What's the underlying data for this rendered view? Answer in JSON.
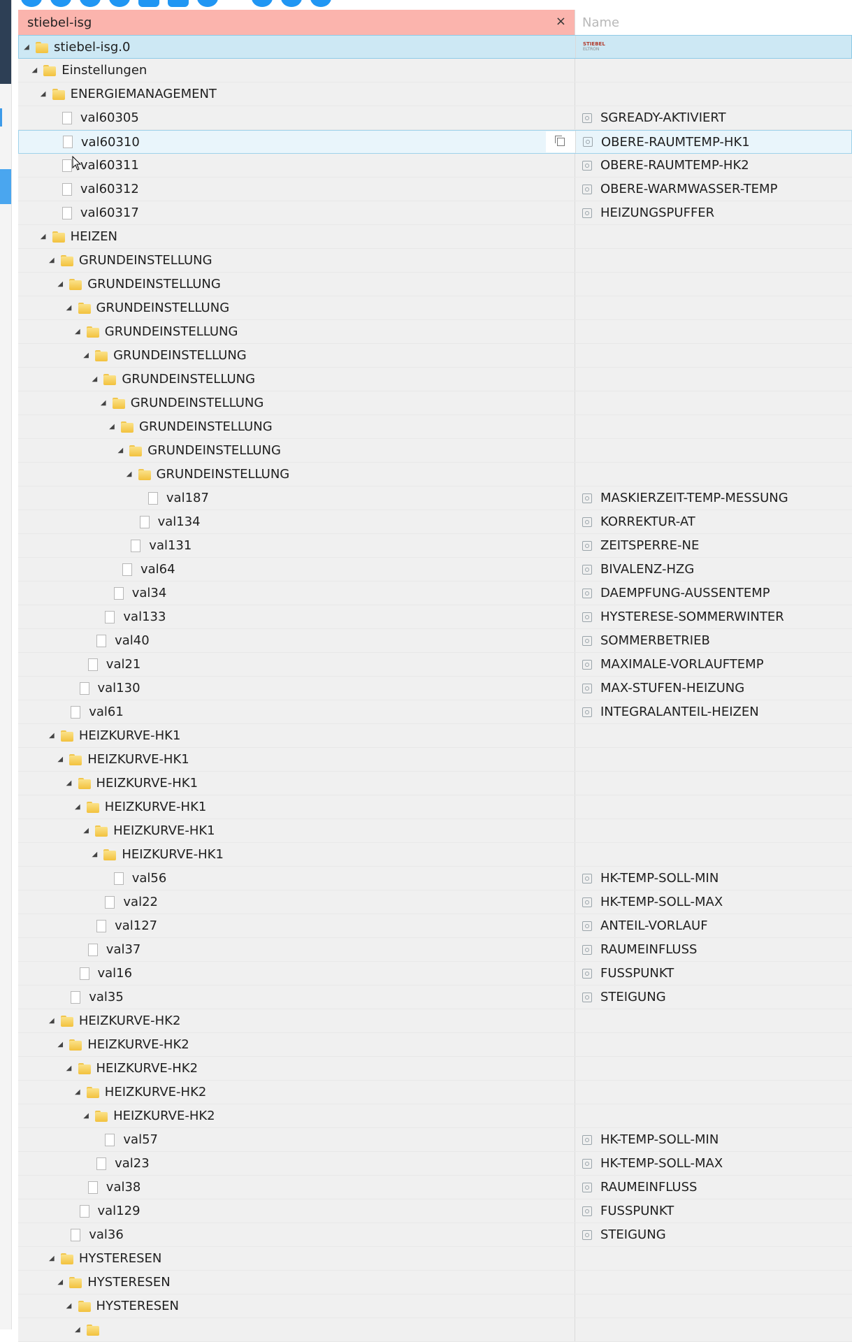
{
  "filter": {
    "value": "stiebel-isg",
    "clear": "×"
  },
  "columns": {
    "name_placeholder": "Name"
  },
  "root": {
    "label": "stiebel-isg.0",
    "logo_top": "STIEBEL",
    "logo_bottom": "ELTRON"
  },
  "rows": [
    {
      "label": "Einstellungen",
      "type": "folder",
      "level": 1,
      "name": ""
    },
    {
      "label": "ENERGIEMANAGEMENT",
      "type": "folder",
      "level": 2,
      "name": ""
    },
    {
      "label": "val60305",
      "type": "file",
      "level": 3,
      "name": "SGREADY-AKTIVIERT"
    },
    {
      "label": "val60310",
      "type": "file",
      "level": 3,
      "name": "OBERE-RAUMTEMP-HK1",
      "hover": true
    },
    {
      "label": "val60311",
      "type": "file",
      "level": 3,
      "name": "OBERE-RAUMTEMP-HK2"
    },
    {
      "label": "val60312",
      "type": "file",
      "level": 3,
      "name": "OBERE-WARMWASSER-TEMP"
    },
    {
      "label": "val60317",
      "type": "file",
      "level": 3,
      "name": "HEIZUNGSPUFFER"
    },
    {
      "label": "HEIZEN",
      "type": "folder",
      "level": 2,
      "name": ""
    },
    {
      "label": "GRUNDEINSTELLUNG",
      "type": "folder",
      "level": 3,
      "name": ""
    },
    {
      "label": "GRUNDEINSTELLUNG",
      "type": "folder",
      "level": 4,
      "name": ""
    },
    {
      "label": "GRUNDEINSTELLUNG",
      "type": "folder",
      "level": 5,
      "name": ""
    },
    {
      "label": "GRUNDEINSTELLUNG",
      "type": "folder",
      "level": 6,
      "name": ""
    },
    {
      "label": "GRUNDEINSTELLUNG",
      "type": "folder",
      "level": 7,
      "name": ""
    },
    {
      "label": "GRUNDEINSTELLUNG",
      "type": "folder",
      "level": 8,
      "name": ""
    },
    {
      "label": "GRUNDEINSTELLUNG",
      "type": "folder",
      "level": 9,
      "name": ""
    },
    {
      "label": "GRUNDEINSTELLUNG",
      "type": "folder",
      "level": 10,
      "name": ""
    },
    {
      "label": "GRUNDEINSTELLUNG",
      "type": "folder",
      "level": 11,
      "name": ""
    },
    {
      "label": "GRUNDEINSTELLUNG",
      "type": "folder",
      "level": 12,
      "name": ""
    },
    {
      "label": "val187",
      "type": "file",
      "level": 13,
      "name": "MASKIERZEIT-TEMP-MESSUNG"
    },
    {
      "label": "val134",
      "type": "file",
      "level": 12,
      "name": "KORREKTUR-AT"
    },
    {
      "label": "val131",
      "type": "file",
      "level": 11,
      "name": "ZEITSPERRE-NE"
    },
    {
      "label": "val64",
      "type": "file",
      "level": 10,
      "name": "BIVALENZ-HZG"
    },
    {
      "label": "val34",
      "type": "file",
      "level": 9,
      "name": "DAEMPFUNG-AUSSENTEMP"
    },
    {
      "label": "val133",
      "type": "file",
      "level": 8,
      "name": "HYSTERESE-SOMMERWINTER"
    },
    {
      "label": "val40",
      "type": "file",
      "level": 7,
      "name": "SOMMERBETRIEB"
    },
    {
      "label": "val21",
      "type": "file",
      "level": 6,
      "name": "MAXIMALE-VORLAUFTEMP"
    },
    {
      "label": "val130",
      "type": "file",
      "level": 5,
      "name": "MAX-STUFEN-HEIZUNG"
    },
    {
      "label": "val61",
      "type": "file",
      "level": 4,
      "name": "INTEGRALANTEIL-HEIZEN"
    },
    {
      "label": "HEIZKURVE-HK1",
      "type": "folder",
      "level": 3,
      "name": ""
    },
    {
      "label": "HEIZKURVE-HK1",
      "type": "folder",
      "level": 4,
      "name": ""
    },
    {
      "label": "HEIZKURVE-HK1",
      "type": "folder",
      "level": 5,
      "name": ""
    },
    {
      "label": "HEIZKURVE-HK1",
      "type": "folder",
      "level": 6,
      "name": ""
    },
    {
      "label": "HEIZKURVE-HK1",
      "type": "folder",
      "level": 7,
      "name": ""
    },
    {
      "label": "HEIZKURVE-HK1",
      "type": "folder",
      "level": 8,
      "name": ""
    },
    {
      "label": "val56",
      "type": "file",
      "level": 9,
      "name": "HK-TEMP-SOLL-MIN"
    },
    {
      "label": "val22",
      "type": "file",
      "level": 8,
      "name": "HK-TEMP-SOLL-MAX"
    },
    {
      "label": "val127",
      "type": "file",
      "level": 7,
      "name": "ANTEIL-VORLAUF"
    },
    {
      "label": "val37",
      "type": "file",
      "level": 6,
      "name": "RAUMEINFLUSS"
    },
    {
      "label": "val16",
      "type": "file",
      "level": 5,
      "name": "FUSSPUNKT"
    },
    {
      "label": "val35",
      "type": "file",
      "level": 4,
      "name": "STEIGUNG"
    },
    {
      "label": "HEIZKURVE-HK2",
      "type": "folder",
      "level": 3,
      "name": ""
    },
    {
      "label": "HEIZKURVE-HK2",
      "type": "folder",
      "level": 4,
      "name": ""
    },
    {
      "label": "HEIZKURVE-HK2",
      "type": "folder",
      "level": 5,
      "name": ""
    },
    {
      "label": "HEIZKURVE-HK2",
      "type": "folder",
      "level": 6,
      "name": ""
    },
    {
      "label": "HEIZKURVE-HK2",
      "type": "folder",
      "level": 7,
      "name": ""
    },
    {
      "label": "val57",
      "type": "file",
      "level": 8,
      "name": "HK-TEMP-SOLL-MIN"
    },
    {
      "label": "val23",
      "type": "file",
      "level": 7,
      "name": "HK-TEMP-SOLL-MAX"
    },
    {
      "label": "val38",
      "type": "file",
      "level": 6,
      "name": "RAUMEINFLUSS"
    },
    {
      "label": "val129",
      "type": "file",
      "level": 5,
      "name": "FUSSPUNKT"
    },
    {
      "label": "val36",
      "type": "file",
      "level": 4,
      "name": "STEIGUNG"
    },
    {
      "label": "HYSTERESEN",
      "type": "folder",
      "level": 3,
      "name": ""
    },
    {
      "label": "HYSTERESEN",
      "type": "folder",
      "level": 4,
      "name": ""
    },
    {
      "label": "HYSTERESEN",
      "type": "folder",
      "level": 5,
      "name": ""
    },
    {
      "label": "",
      "type": "folder",
      "level": 6,
      "name": ""
    }
  ]
}
